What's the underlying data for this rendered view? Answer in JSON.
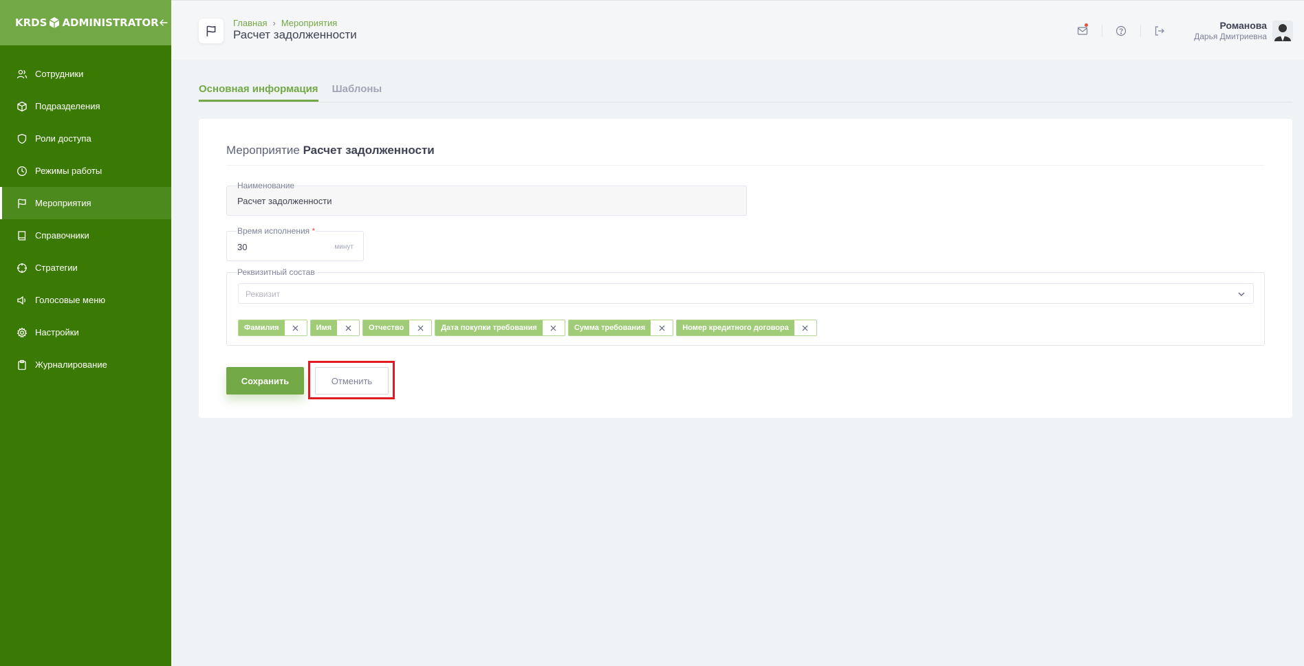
{
  "sidebar": {
    "logo_left": "KRDS",
    "logo_right": "ADMINISTRATOR",
    "items": [
      {
        "label": "Сотрудники",
        "icon": "users-icon"
      },
      {
        "label": "Подразделения",
        "icon": "box-icon"
      },
      {
        "label": "Роли доступа",
        "icon": "shield-icon"
      },
      {
        "label": "Режимы работы",
        "icon": "clock-icon"
      },
      {
        "label": "Мероприятия",
        "icon": "flag-icon",
        "active": true
      },
      {
        "label": "Справочники",
        "icon": "book-icon"
      },
      {
        "label": "Стратегии",
        "icon": "crosshair-icon"
      },
      {
        "label": "Голосовые меню",
        "icon": "speaker-icon"
      },
      {
        "label": "Настройки",
        "icon": "gear-icon"
      },
      {
        "label": "Журналирование",
        "icon": "clipboard-icon"
      }
    ]
  },
  "header": {
    "breadcrumb_home": "Главная",
    "breadcrumb_section": "Мероприятия",
    "title": "Расчет задолженности",
    "user_name": "Романова",
    "user_sub": "Дарья Дмитриевна"
  },
  "tabs": [
    "Основная информация",
    "Шаблоны"
  ],
  "card": {
    "title_prefix": "Мероприятие",
    "title_name": "Расчет задолженности",
    "name_label": "Наименование",
    "name_value": "Расчет задолженности",
    "time_label": "Время исполнения",
    "time_required": "*",
    "time_value": "30",
    "time_unit": "минут",
    "requisites_label": "Реквизитный состав",
    "requisites_placeholder": "Реквизит",
    "tags": [
      "Фамилия",
      "Имя",
      "Отчество",
      "Дата покупки требования",
      "Сумма требования",
      "Номер кредитного договора"
    ],
    "save_label": "Сохранить",
    "cancel_label": "Отменить"
  },
  "colors": {
    "sidebar": "#3a7a04",
    "sidebar_header": "#72a845",
    "accent": "#72a845",
    "tag": "#a0cc78",
    "highlight": "#e01b24"
  }
}
